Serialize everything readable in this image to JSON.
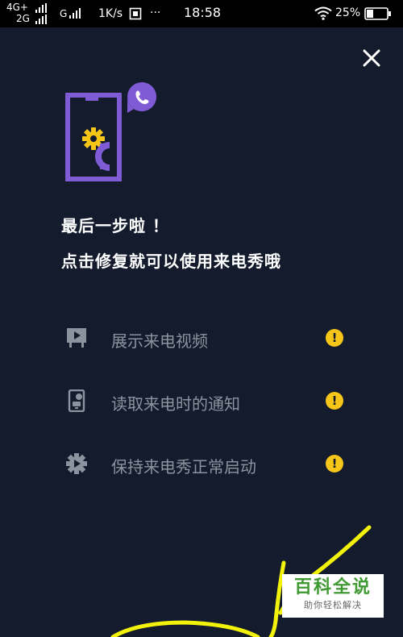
{
  "status_bar": {
    "network_top": "4G+",
    "network_bottom": "2G",
    "network_g": "G",
    "speed": "1K/s",
    "more": "···",
    "time": "18:58",
    "battery": "25%"
  },
  "dialog": {
    "headline_line1": "最后一步啦 ！",
    "headline_line2": "点击修复就可以使用来电秀哦",
    "permissions": [
      {
        "label": "展示来电视频",
        "icon": "video-display-icon",
        "status": "warning"
      },
      {
        "label": "读取来电时的通知",
        "icon": "notification-icon",
        "status": "warning"
      },
      {
        "label": "保持来电秀正常启动",
        "icon": "gear-icon",
        "status": "warning"
      }
    ],
    "warning_glyph": "!"
  },
  "watermark": {
    "title": "百科全说",
    "subtitle": "助你轻松解决"
  },
  "colors": {
    "background": "#131b2d",
    "accent_purple": "#7f5bd6",
    "accent_yellow": "#f5c518",
    "muted_text": "#8d939e",
    "annotation_yellow": "#f2f20a"
  }
}
